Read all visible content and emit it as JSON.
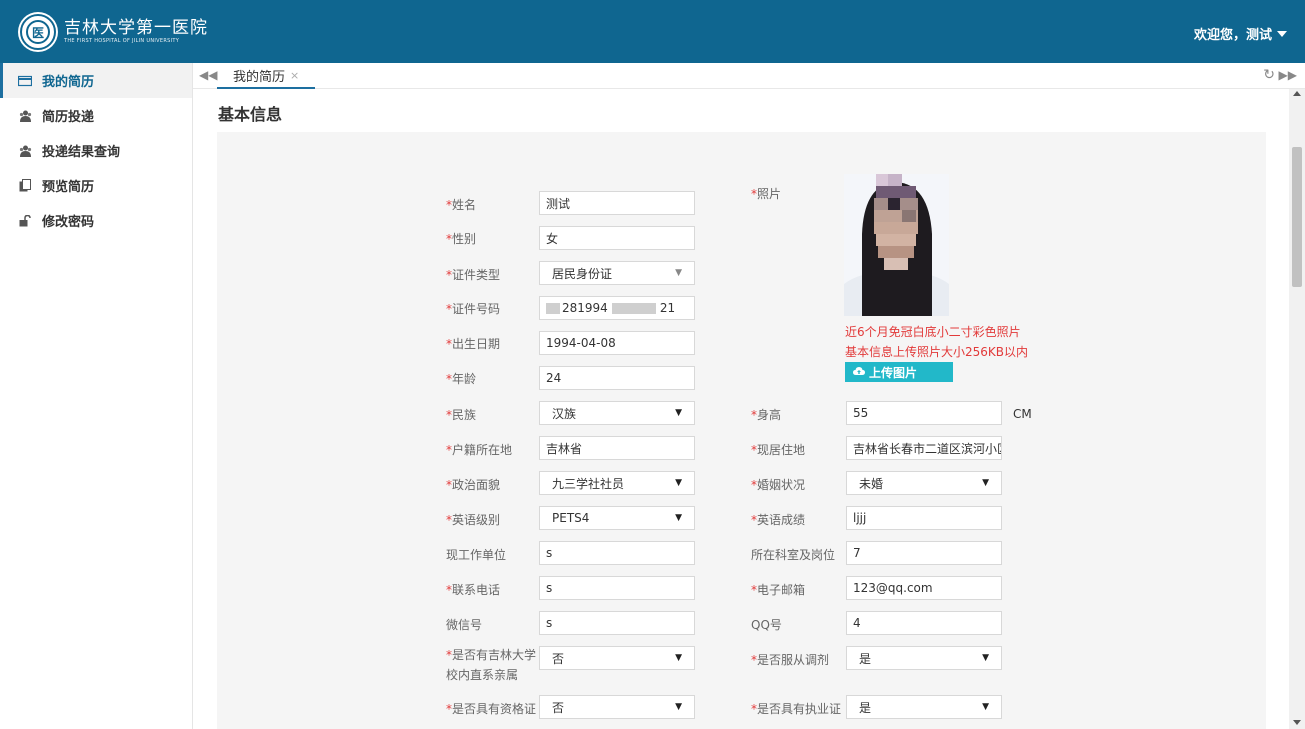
{
  "header": {
    "logo_cn": "吉林大学第一医院",
    "logo_en": "THE FIRST HOSPITAL OF JILIN UNIVERSITY",
    "welcome": "欢迎您，测试"
  },
  "sidebar": {
    "items": [
      {
        "label": "我的简历",
        "icon": "card-icon",
        "active": true
      },
      {
        "label": "简历投递",
        "icon": "users-icon"
      },
      {
        "label": "投递结果查询",
        "icon": "users-icon"
      },
      {
        "label": "预览简历",
        "icon": "copy-icon"
      },
      {
        "label": "修改密码",
        "icon": "unlock-icon"
      }
    ]
  },
  "tabs": [
    {
      "label": "我的简历",
      "close": "×"
    }
  ],
  "main": {
    "section_title": "基本信息",
    "fields": {
      "name": {
        "label": "姓名",
        "value": "测试"
      },
      "gender": {
        "label": "性别",
        "value": "女"
      },
      "id_type": {
        "label": "证件类型",
        "value": "居民身份证"
      },
      "id_number": {
        "label": "证件号码",
        "value": "281994",
        "value_tail": "21"
      },
      "birth_date": {
        "label": "出生日期",
        "value": "1994-04-08"
      },
      "age": {
        "label": "年龄",
        "value": "24"
      },
      "photo": {
        "label": "照片"
      },
      "ethnicity": {
        "label": "民族",
        "value": "汉族"
      },
      "height": {
        "label": "身高",
        "value": "55",
        "unit": "CM"
      },
      "hukou": {
        "label": "户籍所在地",
        "value": "吉林省"
      },
      "residence": {
        "label": "现居住地",
        "value": "吉林省长春市二道区滨河小区"
      },
      "political": {
        "label": "政治面貌",
        "value": "九三学社社员"
      },
      "marital": {
        "label": "婚姻状况",
        "value": "未婚"
      },
      "english_level": {
        "label": "英语级别",
        "value": "PETS4"
      },
      "english_score": {
        "label": "英语成绩",
        "value": "ljjj"
      },
      "employer": {
        "label": "现工作单位",
        "value": "s"
      },
      "department": {
        "label": "所在科室及岗位",
        "value": "7"
      },
      "phone": {
        "label": "联系电话",
        "value": "s"
      },
      "email": {
        "label": "电子邮箱",
        "value": "123@qq.com"
      },
      "wechat": {
        "label": "微信号",
        "value": "s"
      },
      "qq": {
        "label": "QQ号",
        "value": "4"
      },
      "relatives": {
        "label_line1": "是否有吉林大学",
        "label_line2": "校内直系亲属",
        "value": "否"
      },
      "obey_assign": {
        "label": "是否服从调剂",
        "value": "是"
      },
      "qualification": {
        "label": "是否具有资格证",
        "value": "否"
      },
      "license": {
        "label": "是否具有执业证",
        "value": "是"
      }
    },
    "photo_note_1": "近6个月免冠白底小二寸彩色照片",
    "photo_note_2": "基本信息上传照片大小256KB以内",
    "upload_label": "上传图片"
  },
  "colors": {
    "header": "#0f6690",
    "required": "#e23a3a",
    "upload": "#22b8c9"
  }
}
